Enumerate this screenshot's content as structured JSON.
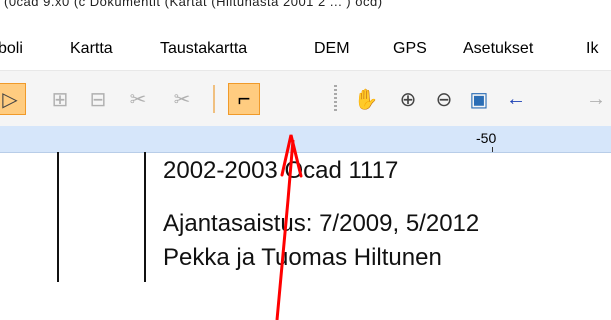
{
  "window": {
    "title": "(0cad 9.x0 (c Dokumentit (Kartat (Hiltunasta 2001 2 ... ) ocd)"
  },
  "menu": {
    "items": [
      {
        "id": "symboli",
        "label": "boli"
      },
      {
        "id": "kartta",
        "label": "Kartta"
      },
      {
        "id": "taustakartta",
        "label": "Taustakartta"
      },
      {
        "id": "dem",
        "label": "DEM"
      },
      {
        "id": "gps",
        "label": "GPS"
      },
      {
        "id": "asetukset",
        "label": "Asetukset"
      },
      {
        "id": "ikkuna",
        "label": "Ik"
      }
    ]
  },
  "toolbar": {
    "tools": [
      {
        "name": "edit-object-icon",
        "glyph": "▷",
        "state": "active"
      },
      {
        "name": "add-vertex-icon",
        "glyph": "⊞",
        "state": "disabled"
      },
      {
        "name": "remove-vertex-icon",
        "glyph": "⊟",
        "state": "disabled"
      },
      {
        "name": "cut-icon",
        "glyph": "✂",
        "state": "disabled"
      },
      {
        "name": "cut-hole-icon",
        "glyph": "✂",
        "state": "disabled"
      },
      {
        "name": "draw-curve-icon",
        "glyph": "⌐",
        "state": "active"
      },
      {
        "name": "pan-hand-icon",
        "glyph": "✋",
        "state": "normal"
      },
      {
        "name": "zoom-in-icon",
        "glyph": "⊕",
        "state": "normal"
      },
      {
        "name": "zoom-out-icon",
        "glyph": "⊖",
        "state": "normal"
      },
      {
        "name": "zoom-window-icon",
        "glyph": "▣",
        "state": "normal"
      },
      {
        "name": "back-arrow-icon",
        "glyph": "←",
        "state": "normal"
      },
      {
        "name": "forward-arrow-icon",
        "glyph": "→",
        "state": "disabled"
      }
    ],
    "accent": "#ffcc80",
    "arrow_color": "#1a3fb5"
  },
  "ruler": {
    "label": "-50"
  },
  "document": {
    "lines": [
      "2002-2003    Ocad 1117",
      "Ajantasaistus: 7/2009, 5/2012",
      "Pekka ja Tuomas Hiltunen"
    ]
  },
  "annotation": {
    "color": "#ff0000"
  }
}
